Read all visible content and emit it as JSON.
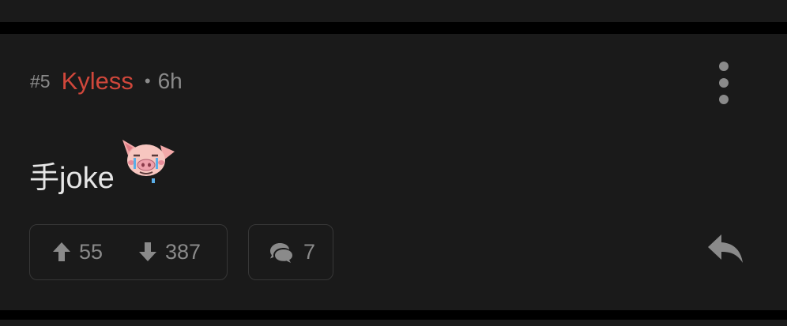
{
  "post": {
    "number": "#5",
    "author": "Kyless",
    "separator": "•",
    "age": "6h",
    "content": "手joke"
  },
  "actions": {
    "upvotes": "55",
    "downvotes": "387",
    "comments": "7"
  },
  "icons": {
    "more": "vertical-ellipsis-icon",
    "upvote": "arrow-up-icon",
    "downvote": "arrow-down-icon",
    "comments": "chat-bubbles-icon",
    "reply": "reply-icon",
    "emoji": "pig-face-emoji"
  },
  "colors": {
    "background": "#1a1a1a",
    "author": "#d0473b",
    "muted": "#8a8a8a",
    "text": "#e6e6e6"
  }
}
